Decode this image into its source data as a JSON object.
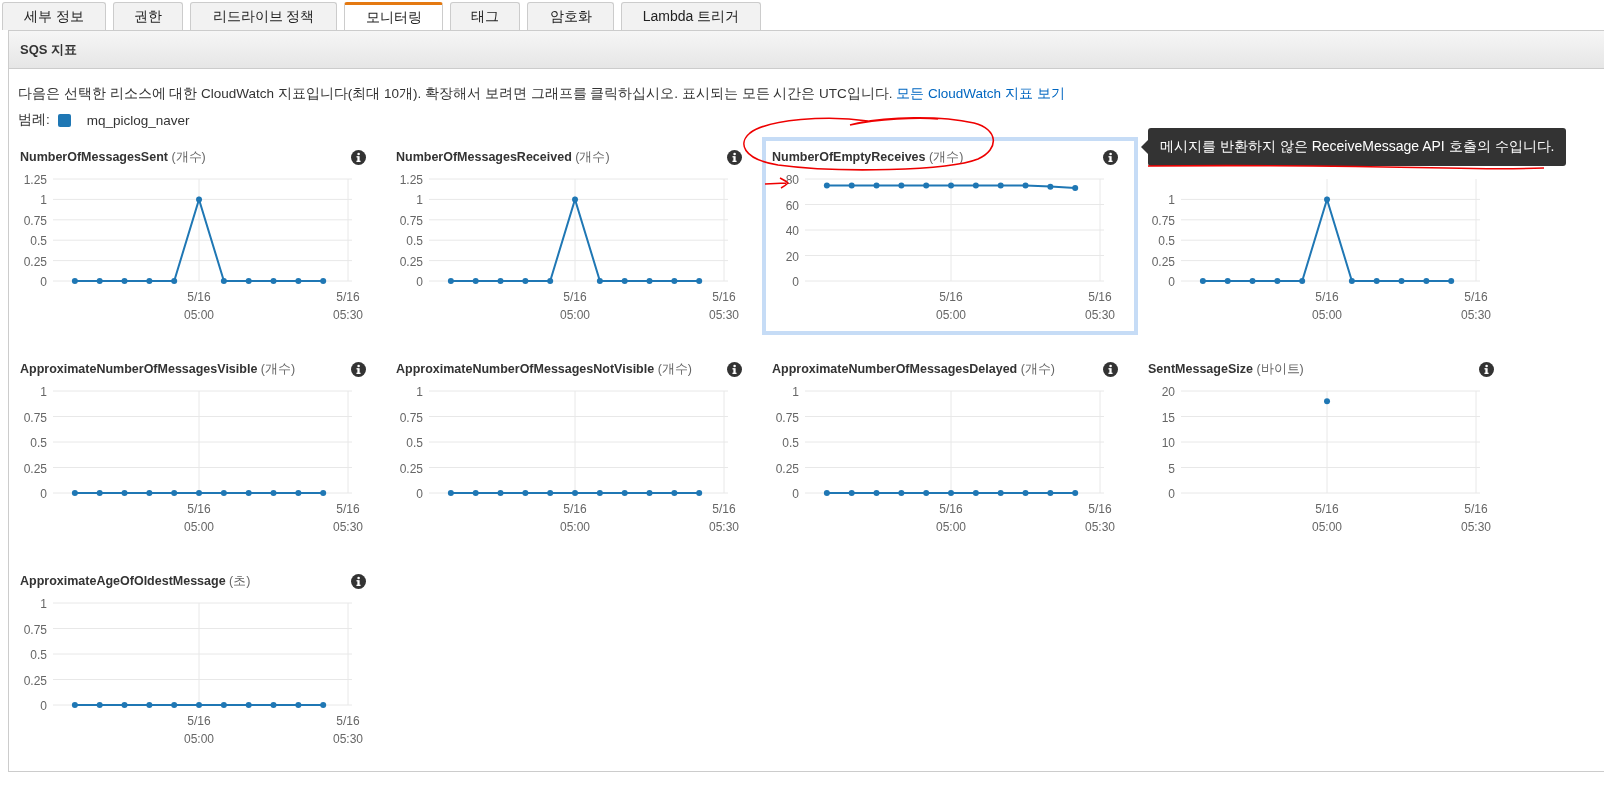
{
  "tabs": [
    {
      "label": "세부 정보",
      "selected": false
    },
    {
      "label": "권한",
      "selected": false
    },
    {
      "label": "리드라이브 정책",
      "selected": false
    },
    {
      "label": "모니터링",
      "selected": true
    },
    {
      "label": "태그",
      "selected": false
    },
    {
      "label": "암호화",
      "selected": false
    },
    {
      "label": "Lambda 트리거",
      "selected": false
    }
  ],
  "panel": {
    "title": "SQS 지표",
    "description": "다음은 선택한 리소스에 대한 CloudWatch 지표입니다(최대 10개). 확장해서 보려면 그래프를 클릭하십시오. 표시되는 모든 시간은 UTC입니다.",
    "link": "모든 CloudWatch 지표 보기",
    "legend": {
      "label": "범례:",
      "name": "mq_piclog_naver",
      "color": "#1f77b4"
    }
  },
  "charts": [
    {
      "title": "NumberOfMessagesSent",
      "unit": "(개수)",
      "selected": false,
      "chart_data": {
        "type": "line",
        "categories": [
          null,
          null,
          null,
          null,
          null,
          "5/16 05:00",
          null,
          null,
          null,
          null,
          null,
          "5/16 05:30"
        ],
        "series": [
          {
            "color": "#1f77b4",
            "marker": "circle",
            "values": [
              0,
              0,
              0,
              0,
              0,
              1,
              0,
              0,
              0,
              0,
              0,
              null
            ]
          }
        ],
        "ylim": [
          0,
          1.25
        ],
        "yticks": [
          0,
          0.25,
          0.5,
          0.75,
          1,
          1.25
        ],
        "grid": true
      }
    },
    {
      "title": "NumberOfMessagesReceived",
      "unit": "(개수)",
      "selected": false,
      "chart_data": {
        "type": "line",
        "categories": [
          null,
          null,
          null,
          null,
          null,
          "5/16 05:00",
          null,
          null,
          null,
          null,
          null,
          "5/16 05:30"
        ],
        "series": [
          {
            "color": "#1f77b4",
            "marker": "circle",
            "values": [
              0,
              0,
              0,
              0,
              0,
              1,
              0,
              0,
              0,
              0,
              0,
              null
            ]
          }
        ],
        "ylim": [
          0,
          1.25
        ],
        "yticks": [
          0,
          0.25,
          0.5,
          0.75,
          1,
          1.25
        ],
        "grid": true
      }
    },
    {
      "title": "NumberOfEmptyReceives",
      "unit": "(개수)",
      "selected": true,
      "tooltip": "메시지를 반환하지 않은 ReceiveMessage API 호출의 수입니다.",
      "chart_data": {
        "type": "line",
        "categories": [
          null,
          null,
          null,
          null,
          null,
          "5/16 05:00",
          null,
          null,
          null,
          null,
          null,
          "5/16 05:30"
        ],
        "series": [
          {
            "color": "#1f77b4",
            "marker": "circle",
            "values": [
              75,
              75,
              75,
              75,
              75,
              75,
              75,
              75,
              75,
              74,
              73,
              null
            ]
          }
        ],
        "ylim": [
          0,
          80
        ],
        "yticks": [
          0,
          20,
          40,
          60,
          80
        ],
        "grid": true
      }
    },
    {
      "selected": false,
      "chart_data": {
        "type": "line",
        "categories": [
          null,
          null,
          null,
          null,
          null,
          "5/16 05:00",
          null,
          null,
          null,
          null,
          null,
          "5/16 05:30"
        ],
        "series": [
          {
            "color": "#1f77b4",
            "marker": "circle",
            "values": [
              0,
              0,
              0,
              0,
              0,
              1,
              0,
              0,
              0,
              0,
              0,
              null
            ]
          }
        ],
        "ylim": [
          0,
          1.25
        ],
        "yticks": [
          0,
          0.25,
          0.5,
          0.75,
          1
        ],
        "grid": true
      }
    },
    {
      "title": "ApproximateNumberOfMessagesVisible",
      "unit": "(개수)",
      "selected": false,
      "chart_data": {
        "type": "line",
        "categories": [
          null,
          null,
          null,
          null,
          null,
          "5/16 05:00",
          null,
          null,
          null,
          null,
          null,
          "5/16 05:30"
        ],
        "series": [
          {
            "color": "#1f77b4",
            "marker": "circle",
            "values": [
              0,
              0,
              0,
              0,
              0,
              0,
              0,
              0,
              0,
              0,
              0,
              null
            ]
          }
        ],
        "ylim": [
          0,
          1
        ],
        "yticks": [
          0,
          0.25,
          0.5,
          0.75,
          1
        ],
        "grid": true
      }
    },
    {
      "title": "ApproximateNumberOfMessagesNotVisible",
      "unit": "(개수)",
      "selected": false,
      "chart_data": {
        "type": "line",
        "categories": [
          null,
          null,
          null,
          null,
          null,
          "5/16 05:00",
          null,
          null,
          null,
          null,
          null,
          "5/16 05:30"
        ],
        "series": [
          {
            "color": "#1f77b4",
            "marker": "circle",
            "values": [
              0,
              0,
              0,
              0,
              0,
              0,
              0,
              0,
              0,
              0,
              0,
              null
            ]
          }
        ],
        "ylim": [
          0,
          1
        ],
        "yticks": [
          0,
          0.25,
          0.5,
          0.75,
          1
        ],
        "grid": true
      }
    },
    {
      "title": "ApproximateNumberOfMessagesDelayed",
      "unit": "(개수)",
      "selected": false,
      "chart_data": {
        "type": "line",
        "categories": [
          null,
          null,
          null,
          null,
          null,
          "5/16 05:00",
          null,
          null,
          null,
          null,
          null,
          "5/16 05:30"
        ],
        "series": [
          {
            "color": "#1f77b4",
            "marker": "circle",
            "values": [
              0,
              0,
              0,
              0,
              0,
              0,
              0,
              0,
              0,
              0,
              0,
              null
            ]
          }
        ],
        "ylim": [
          0,
          1
        ],
        "yticks": [
          0,
          0.25,
          0.5,
          0.75,
          1
        ],
        "grid": true
      }
    },
    {
      "title": "SentMessageSize",
      "unit": "(바이트)",
      "selected": false,
      "chart_data": {
        "type": "scatter",
        "categories": [
          null,
          null,
          null,
          null,
          null,
          "5/16 05:00",
          null,
          null,
          null,
          null,
          null,
          "5/16 05:30"
        ],
        "series": [
          {
            "color": "#1f77b4",
            "values": [
              null,
              null,
              null,
              null,
              null,
              18,
              null,
              null,
              null,
              null,
              null,
              null
            ]
          }
        ],
        "ylim": [
          0,
          20
        ],
        "yticks": [
          0,
          5,
          10,
          15,
          20
        ],
        "grid": true
      }
    },
    {
      "title": "ApproximateAgeOfOldestMessage",
      "unit": "(초)",
      "selected": false,
      "chart_data": {
        "type": "line",
        "categories": [
          null,
          null,
          null,
          null,
          null,
          "5/16 05:00",
          null,
          null,
          null,
          null,
          null,
          "5/16 05:30"
        ],
        "series": [
          {
            "color": "#1f77b4",
            "marker": "circle",
            "values": [
              0,
              0,
              0,
              0,
              0,
              0,
              0,
              0,
              0,
              0,
              0,
              null
            ]
          }
        ],
        "ylim": [
          0,
          1
        ],
        "yticks": [
          0,
          0.25,
          0.5,
          0.75,
          1
        ],
        "grid": true
      }
    }
  ],
  "annotations": [
    {
      "kind": "ellipse"
    },
    {
      "kind": "arrow"
    },
    {
      "kind": "underline"
    }
  ]
}
